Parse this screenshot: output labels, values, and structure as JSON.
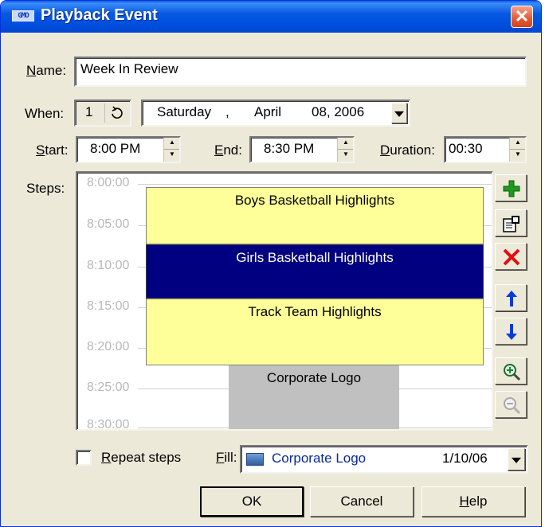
{
  "window": {
    "title": "Playback Event",
    "title_icon_text": "GMO",
    "close_symbol": "✕"
  },
  "name_field": {
    "label": "Name:",
    "label_accel": "N",
    "label_rest": "ame:",
    "value": "Week In Review"
  },
  "when": {
    "label": "When:",
    "count": "1",
    "day": "Saturday",
    "comma": ",",
    "month": "April",
    "date_year": "08, 2006"
  },
  "start": {
    "accel": "S",
    "rest": "tart:",
    "value": "8:00 PM"
  },
  "end": {
    "accel": "E",
    "rest": "nd:",
    "value": "8:30 PM"
  },
  "duration": {
    "accel": "D",
    "rest": "uration:",
    "value": "00:30"
  },
  "steps": {
    "label": "Steps:",
    "ticks": [
      "8:00:00",
      "8:05:00",
      "8:10:00",
      "8:15:00",
      "8:20:00",
      "8:25:00",
      "8:30:00"
    ],
    "items": [
      {
        "title": "Boys Basketball Highlights",
        "color": "#ffff99"
      },
      {
        "title": "Girls Basketball Highlights",
        "color": "#000080"
      },
      {
        "title": "Track Team Highlights",
        "color": "#ffff99"
      },
      {
        "title": "Corporate Logo",
        "color": "#c0c0c0"
      }
    ]
  },
  "side_buttons": [
    "add-icon",
    "properties-icon",
    "delete-icon",
    "move-up-icon",
    "move-down-icon",
    "zoom-in-icon",
    "zoom-out-icon"
  ],
  "repeat": {
    "accel": "R",
    "rest": "epeat steps",
    "checked": false
  },
  "fill": {
    "accel": "F",
    "rest": "ill:",
    "name": "Corporate Logo",
    "date": "1/10/06"
  },
  "buttons": {
    "ok": "OK",
    "cancel": "Cancel",
    "help_accel": "H",
    "help_rest": "elp"
  }
}
